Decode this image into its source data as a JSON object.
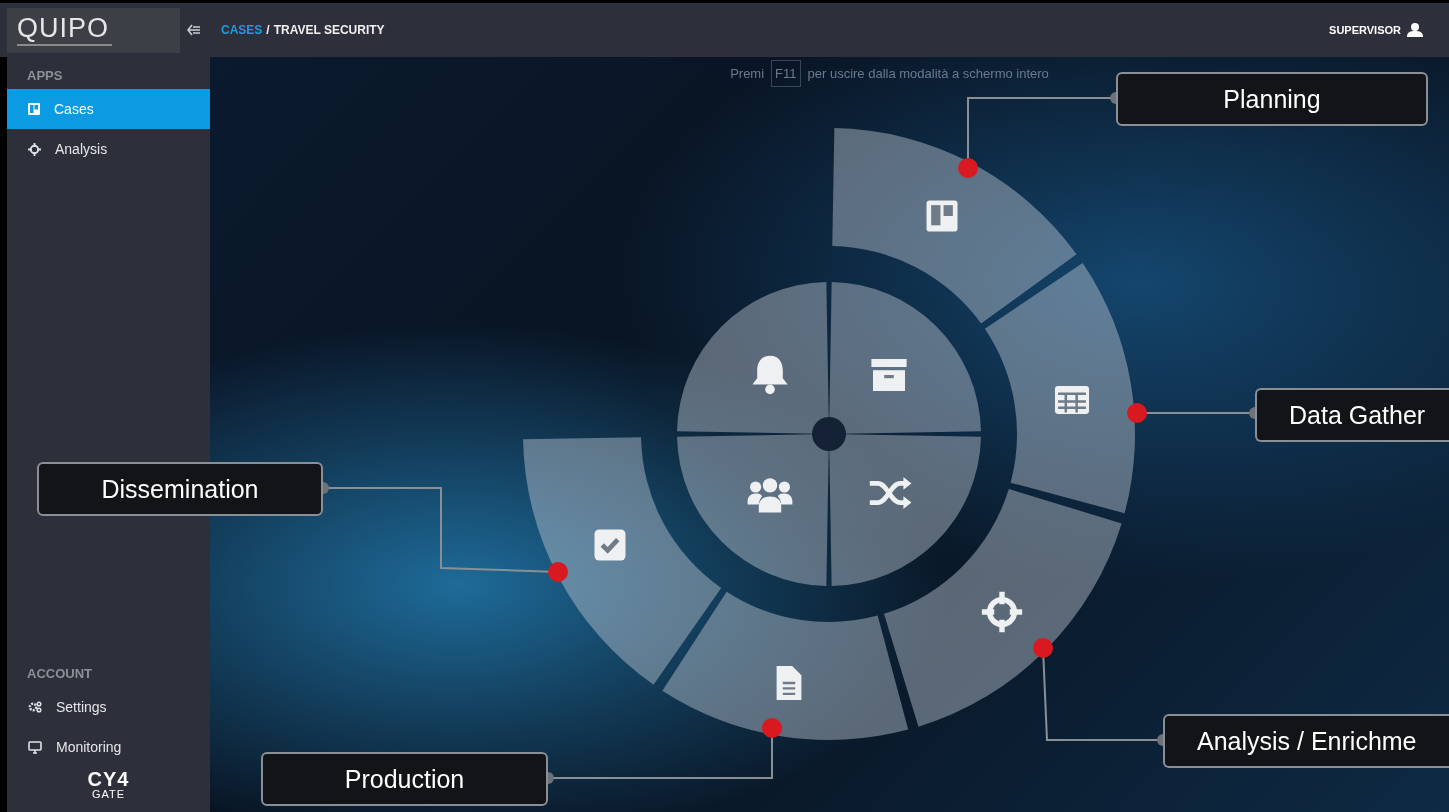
{
  "header": {
    "logo": {
      "name": "QUIPO"
    },
    "breadcrumb": [
      {
        "label": "CASES",
        "kind": "link"
      },
      {
        "label": "TRAVEL SECURITY",
        "kind": "current"
      }
    ],
    "separator": "/",
    "user": "SUPERVISOR"
  },
  "fullscreen_notice": {
    "before": "Premi",
    "key": "F11",
    "after": "per uscire dalla modalità a schermo intero"
  },
  "sidebar": {
    "sections": [
      {
        "title": "APPS",
        "items": [
          {
            "label": "Cases",
            "selected": true
          },
          {
            "label": "Analysis",
            "selected": false
          }
        ]
      },
      {
        "title": "ACCOUNT",
        "items": [
          {
            "label": "Settings",
            "selected": false
          },
          {
            "label": "Monitoring",
            "selected": false
          }
        ]
      }
    ],
    "footer_logo": {
      "mark": "CY4",
      "name": "GATE"
    }
  },
  "cycle": {
    "phases": [
      {
        "label": "Planning"
      },
      {
        "label": "Data Gather"
      },
      {
        "label": "Analysis / Enrichme"
      },
      {
        "label": "Production"
      },
      {
        "label": "Dissemination"
      }
    ]
  }
}
